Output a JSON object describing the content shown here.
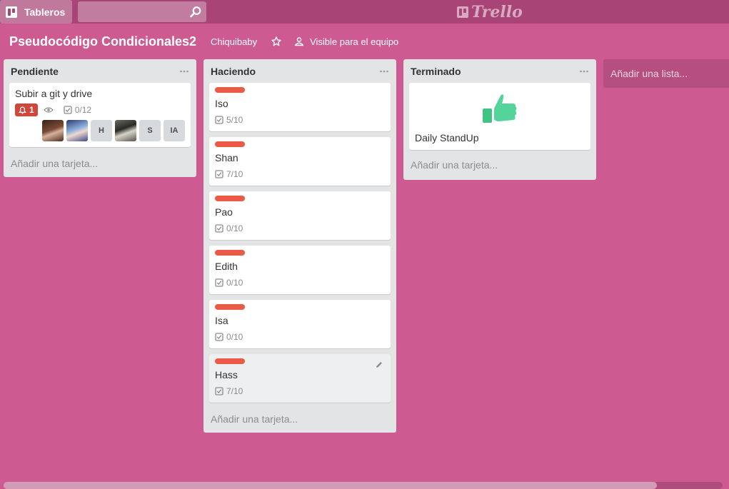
{
  "header": {
    "boards_label": "Tableros",
    "search_placeholder": "",
    "logo_text": "Trello"
  },
  "board": {
    "title": "Pseudocódigo Condicionales2",
    "team": "Chiquibaby",
    "visibility": "Visible para el equipo"
  },
  "colors": {
    "background": "#cd5a91",
    "header": "#a84476",
    "label_red": "#eb5a46",
    "alert": "#d2453a"
  },
  "lists": [
    {
      "title": "Pendiente",
      "add_card": "Añadir una tarjeta...",
      "cards": [
        {
          "title": "Subir a git y drive",
          "alert_count": "1",
          "watching_icon": "eye-icon",
          "checklist": "0/12",
          "members": [
            "avatar",
            "avatar",
            "H",
            "avatar",
            "S",
            "IA"
          ]
        }
      ]
    },
    {
      "title": "Haciendo",
      "add_card": "Añadir una tarjeta...",
      "cards": [
        {
          "title": "Iso",
          "checklist": "5/10"
        },
        {
          "title": "Shan",
          "checklist": "7/10"
        },
        {
          "title": "Pao",
          "checklist": "0/10"
        },
        {
          "title": "Edith",
          "checklist": "0/10"
        },
        {
          "title": "Isa",
          "checklist": "0/10"
        },
        {
          "title": "Hass",
          "checklist": "7/10"
        }
      ]
    },
    {
      "title": "Terminado",
      "add_card": "Añadir una tarjeta...",
      "cards": [
        {
          "title": "Daily StandUp",
          "cover_icon": "thumbs-up-icon"
        }
      ]
    }
  ],
  "add_list": "Añadir una lista..."
}
